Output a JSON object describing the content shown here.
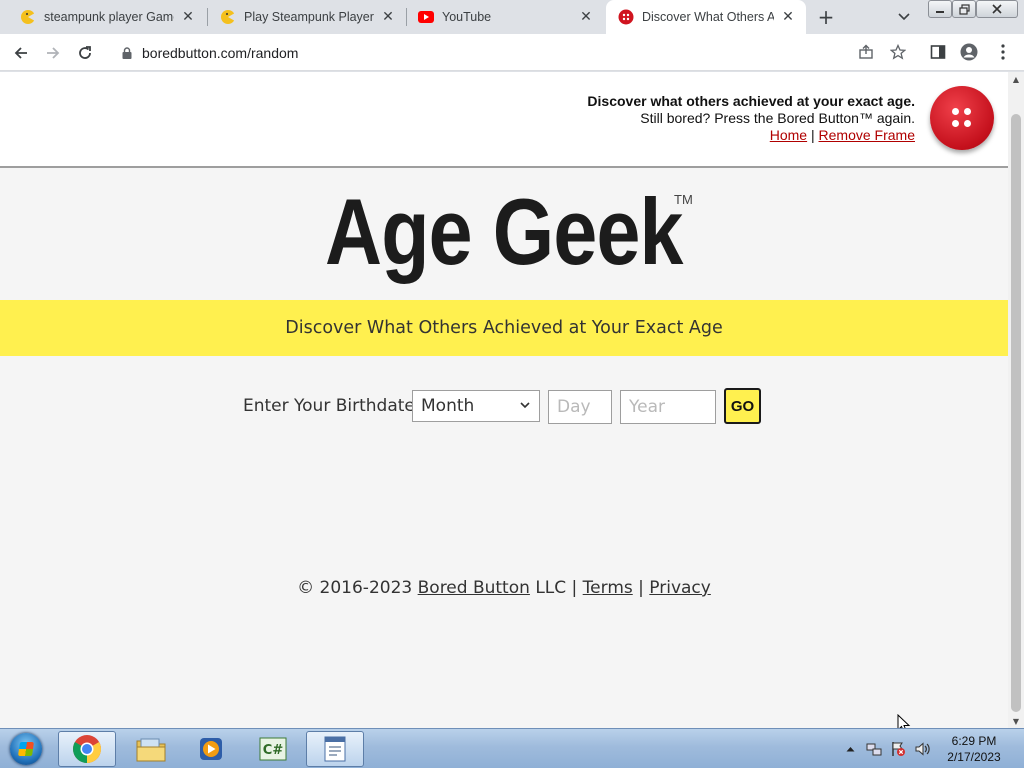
{
  "browser": {
    "tabs": [
      {
        "title": "steampunk player Games",
        "favicon": "pacman-icon",
        "active": false
      },
      {
        "title": "Play Steampunk Player Pa",
        "favicon": "pacman-icon",
        "active": false
      },
      {
        "title": "YouTube",
        "favicon": "youtube-icon",
        "active": false
      },
      {
        "title": "Discover What Others Ac",
        "favicon": "bored-button-icon",
        "active": true
      }
    ],
    "url": "boredbutton.com/random"
  },
  "frame": {
    "headline": "Discover what others achieved at your exact age.",
    "subline": "Still bored? Press the Bored Button™ again.",
    "home_link": "Home",
    "separator": "|",
    "remove_frame_link": "Remove Frame"
  },
  "page": {
    "logo": "Age Geek",
    "trademark": "TM",
    "tagline": "Discover What Others Achieved at Your Exact Age",
    "form": {
      "label": "Enter Your Birthdate:",
      "month_value": "Month",
      "day_placeholder": "Day",
      "year_placeholder": "Year",
      "go_label": "GO"
    },
    "footer": {
      "copyright": "© 2016-2023",
      "company_link": "Bored Button",
      "company_suffix": "LLC",
      "sep": "|",
      "terms_link": "Terms",
      "privacy_link": "Privacy"
    }
  },
  "taskbar": {
    "apps": [
      "chrome-icon",
      "file-explorer-icon",
      "media-player-icon",
      "csharp-editor-icon",
      "document-app-icon"
    ],
    "time": "6:29 PM",
    "date": "2/17/2023"
  },
  "colors": {
    "banner": "#fff04f",
    "link_red": "#b00000",
    "bored_button": "#d0141f"
  }
}
